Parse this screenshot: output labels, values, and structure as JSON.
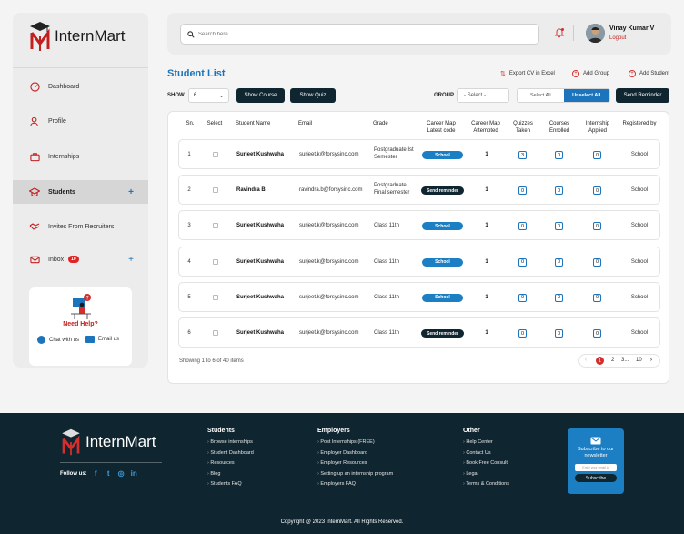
{
  "brand": {
    "name": "InternMart"
  },
  "sidebar": {
    "items": [
      {
        "label": "Dashboard",
        "icon": "dashboard-icon"
      },
      {
        "label": "Profile",
        "icon": "profile-icon"
      },
      {
        "label": "Internships",
        "icon": "briefcase-icon"
      },
      {
        "label": "Students",
        "icon": "graduation-cap-icon",
        "active": true,
        "plus": "+"
      },
      {
        "label": "Invites From Recruiters",
        "icon": "handshake-icon"
      },
      {
        "label": "Inbox",
        "icon": "mail-icon",
        "badge": "10",
        "plus": "+"
      }
    ],
    "help": {
      "title": "Need Help?",
      "chat": "Chat with us",
      "email": "Email us"
    }
  },
  "topbar": {
    "search_placeholder": "Search here",
    "user_name": "Vinay Kumar V",
    "logout": "Logout"
  },
  "main": {
    "title": "Student List",
    "export_label": "Export CV in Excel",
    "add_group_label": "Add Group",
    "add_student_label": "Add Student",
    "show_label": "SHOW",
    "show_value": "6",
    "show_course_label": "Show Course",
    "show_quiz_label": "Show Quiz",
    "group_label": "GROUP",
    "group_value": "- Select -",
    "select_all_label": "Select All",
    "unselect_all_label": "Unselect All",
    "send_reminder_label": "Send Reminder"
  },
  "table": {
    "headers": [
      "Sn.",
      "Select",
      "Student Name",
      "Email",
      "Grade",
      "Career Map Latest code",
      "Career Map Attempted",
      "Quizzes Taken",
      "Courses Enrolled",
      "Internship Applied",
      "Registered by"
    ],
    "rows": [
      {
        "sn": "1",
        "name": "Surjeet Kushwaha",
        "email": "surjeet.k@forsysinc.com",
        "grade": "Postgraduate Ist Semester",
        "code": "School",
        "code_type": "school",
        "attempted": "1",
        "quizzes": "3",
        "courses": "0",
        "internships": "0",
        "registered": "School"
      },
      {
        "sn": "2",
        "name": "Ravindra B",
        "email": "ravindra.b@forsysinc.com",
        "grade": "Postgraduate Final semester",
        "code": "Send reminder",
        "code_type": "remind",
        "attempted": "1",
        "quizzes": "0",
        "courses": "0",
        "internships": "0",
        "registered": "School"
      },
      {
        "sn": "3",
        "name": "Surjeet Kushwaha",
        "email": "surjeet.k@forsysinc.com",
        "grade": "Class 11th",
        "code": "School",
        "code_type": "school",
        "attempted": "1",
        "quizzes": "0",
        "courses": "0",
        "internships": "0",
        "registered": "School"
      },
      {
        "sn": "4",
        "name": "Surjeet Kushwaha",
        "email": "surjeet.k@forsysinc.com",
        "grade": "Class 11th",
        "code": "School",
        "code_type": "school",
        "attempted": "1",
        "quizzes": "0",
        "courses": "0",
        "internships": "0",
        "registered": "School"
      },
      {
        "sn": "5",
        "name": "Surjeet Kushwaha",
        "email": "surjeet.k@forsysinc.com",
        "grade": "Class 11th",
        "code": "School",
        "code_type": "school",
        "attempted": "1",
        "quizzes": "0",
        "courses": "0",
        "internships": "0",
        "registered": "School"
      },
      {
        "sn": "6",
        "name": "Surjeet Kushwaha",
        "email": "surjeet.k@forsysinc.com",
        "grade": "Class 11th",
        "code": "Send reminder",
        "code_type": "remind",
        "attempted": "1",
        "quizzes": "0",
        "courses": "0",
        "internships": "0",
        "registered": "School"
      }
    ],
    "showing": "Showing 1 to 6 of 40 items",
    "pagination": {
      "prev": "‹",
      "pages": [
        "1",
        "2",
        "3...",
        "10"
      ],
      "current": "1",
      "next": "›"
    }
  },
  "footer": {
    "follow_label": "Follow us:",
    "students": {
      "title": "Students",
      "links": [
        "Browse internships",
        "Student Dashboard",
        "Resources",
        "Blog",
        "Students FAQ"
      ]
    },
    "employers": {
      "title": "Employers",
      "links": [
        "Post Internships (FREE)",
        "Employer Dashboard",
        "Employer Resources",
        "Setting up an internship program",
        "Employers FAQ"
      ]
    },
    "other": {
      "title": "Other",
      "links": [
        "Help Center",
        "Contact Us",
        "Book Free Consult",
        "Legal",
        "Terms & Conditions"
      ]
    },
    "newsletter": {
      "text": "Subscribe to our newsletter",
      "placeholder": "Enter your email id",
      "button": "Subscribe"
    },
    "copyright": "Copyright @ 2023 InternMart. All Rights Reserved."
  },
  "colors": {
    "accent": "#1c75bc",
    "brand_red": "#d32f2f",
    "dark": "#0f2530"
  }
}
